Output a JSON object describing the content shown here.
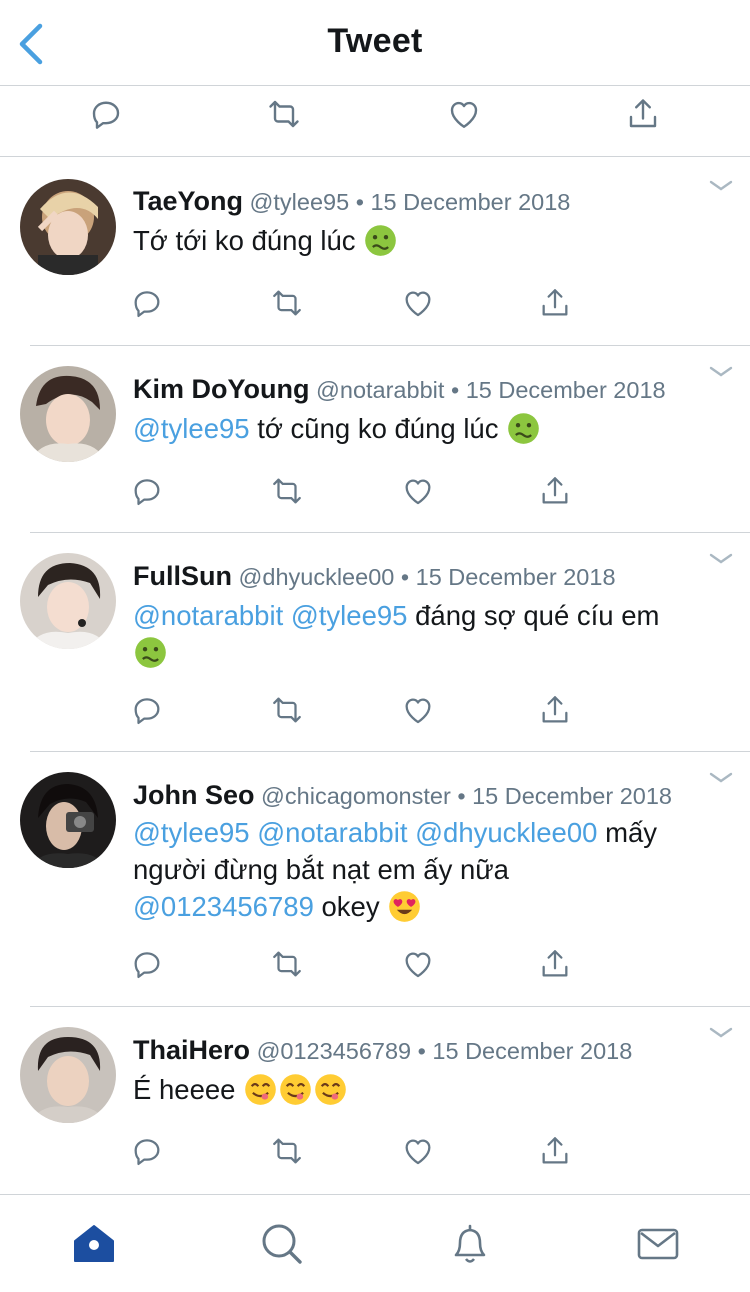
{
  "header": {
    "title": "Tweet",
    "back_icon": "chevron-left-icon"
  },
  "main_actions": [
    "reply-icon",
    "retweet-icon",
    "like-icon",
    "share-icon"
  ],
  "tweets": [
    {
      "name": "TaeYong",
      "handle": "@tylee95",
      "sep": "•",
      "date": "15 December 2018",
      "mentions": "",
      "text": "Tớ tới ko đúng lúc",
      "text2": "",
      "mention3": "",
      "text3": "",
      "emojis": [
        "nauseated-face"
      ]
    },
    {
      "name": "Kim DoYoung",
      "handle": "@notarabbit",
      "sep": "•",
      "date": "15 December 2018",
      "mentions": "@tylee95",
      "text": "tớ cũng ko đúng lúc",
      "text2": "",
      "mention3": "",
      "text3": "",
      "emojis": [
        "nauseated-face"
      ]
    },
    {
      "name": "FullSun",
      "handle": "@dhyucklee00",
      "sep": "•",
      "date": "15 December 2018",
      "mentions": "@notarabbit @tylee95",
      "text": "đáng sợ qué cíu em",
      "text2": "",
      "mention3": "",
      "text3": "",
      "emojis": [
        "nauseated-face"
      ]
    },
    {
      "name": "John Seo",
      "handle": "@chicagomonster",
      "sep": "•",
      "date": "15 December 2018",
      "mentions": "@tylee95 @notarabbit @dhyucklee00",
      "text": "mấy",
      "text2": "người đừng bắt nạt em ấy nữa",
      "mention3": "@0123456789",
      "text3": "okey",
      "emojis": [
        "heart-eyes-face"
      ]
    },
    {
      "name": "ThaiHero",
      "handle": "@0123456789",
      "sep": "•",
      "date": "15 December 2018",
      "mentions": "",
      "text": "É heeee",
      "text2": "",
      "mention3": "",
      "text3": "",
      "emojis": [
        "yum-face",
        "yum-face",
        "yum-face"
      ]
    }
  ],
  "tabs": [
    "home-icon",
    "search-icon",
    "notifications-icon",
    "messages-icon"
  ],
  "colors": {
    "accent": "#1da1f2",
    "mention": "#4aa0e0",
    "icon": "#657786",
    "tab_active": "#1c4ea0"
  }
}
